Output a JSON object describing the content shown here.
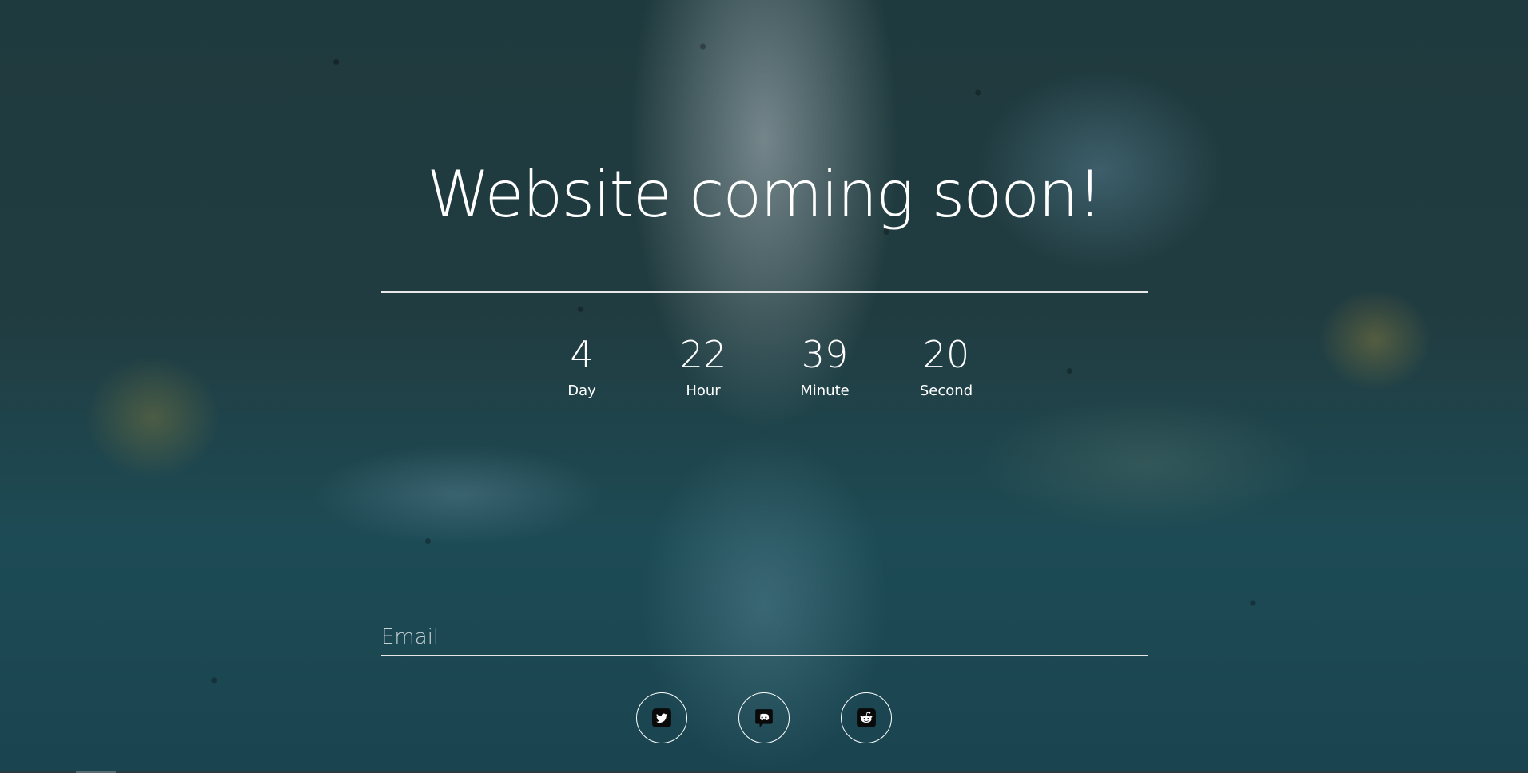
{
  "hero": {
    "title": "Website coming soon!"
  },
  "countdown": [
    {
      "value": "4",
      "label": "Day"
    },
    {
      "value": "22",
      "label": "Hour"
    },
    {
      "value": "39",
      "label": "Minute"
    },
    {
      "value": "20",
      "label": "Second"
    }
  ],
  "signup": {
    "email_placeholder": "Email",
    "email_value": ""
  },
  "social": [
    {
      "icon": "twitter-icon"
    },
    {
      "icon": "discord-icon"
    },
    {
      "icon": "reddit-icon"
    }
  ],
  "colors": {
    "text": "#ffffff",
    "line": "#e9e9e9",
    "icon_bg": "#0a0a0a"
  }
}
